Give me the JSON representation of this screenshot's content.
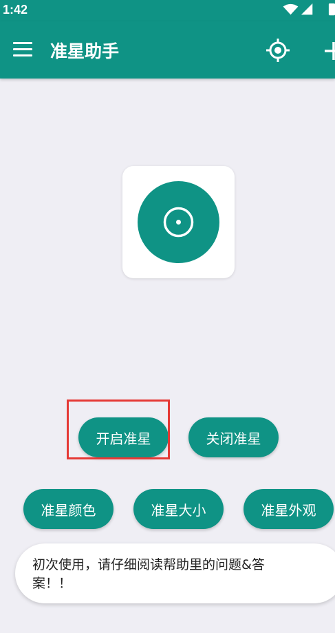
{
  "status_bar": {
    "time": "1:42",
    "icons": [
      "wifi-icon",
      "signal-icon",
      "battery-icon"
    ]
  },
  "app_bar": {
    "title": "准星助手",
    "actions": [
      "menu-icon",
      "target-icon",
      "add-icon"
    ]
  },
  "preview": {
    "icon": "crosshair-target-icon"
  },
  "buttons": {
    "enable": "开启准星",
    "disable": "关闭准星",
    "color": "准星颜色",
    "size": "准星大小",
    "appearance": "准星外观"
  },
  "toast": {
    "message": "初次使用，请仔细阅读帮助里的问题&答案！！"
  },
  "colors": {
    "primary": "#0f9385",
    "background": "#efeef4",
    "highlight": "#e53935"
  }
}
